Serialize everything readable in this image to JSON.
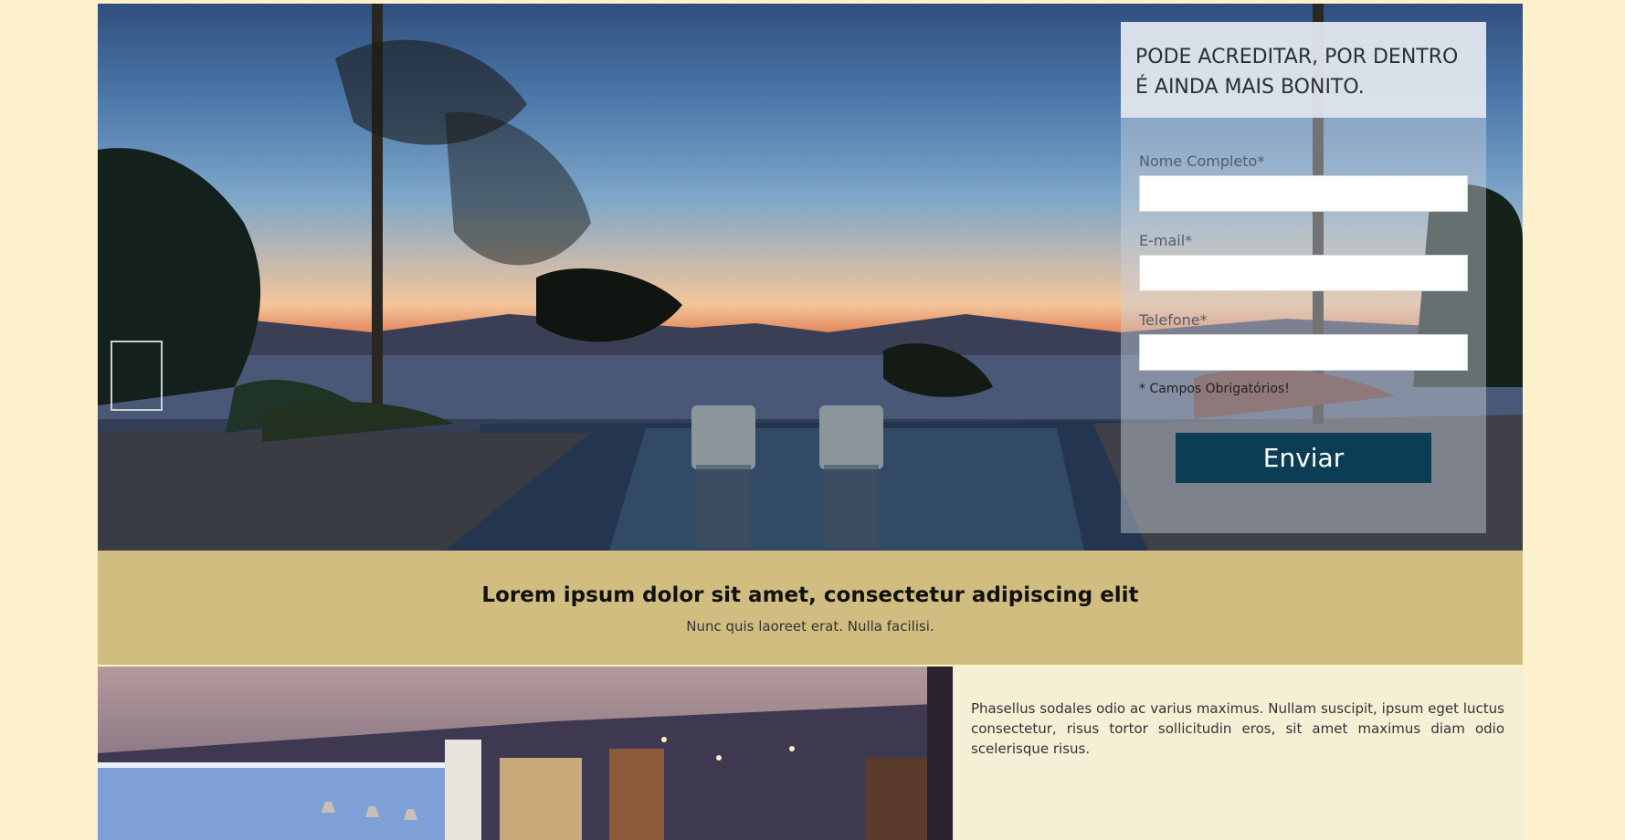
{
  "hero": {
    "image_alt": "sunset-pool-view",
    "form": {
      "title": "PODE ACREDITAR, POR DENTRO É AINDA MAIS BONITO.",
      "fields": [
        {
          "label": "Nome Completo*",
          "value": ""
        },
        {
          "label": "E-mail*",
          "value": ""
        },
        {
          "label": "Telefone*",
          "value": ""
        }
      ],
      "required_note": "* Campos Obrigatórios!",
      "submit_label": "Enviar"
    }
  },
  "band": {
    "title": "Lorem ipsum dolor sit amet, consectetur adipiscing elit",
    "subtitle": "Nunc quis laoreet erat. Nulla facilisi."
  },
  "lower": {
    "image_alt": "interior-lounge",
    "text": "Phasellus sodales odio ac varius maximus. Nullam suscipit, ipsum eget luctus consectetur, risus tortor sollicitudin eros, sit amet maximus diam odio scelerisque risus."
  },
  "colors": {
    "page_bg": "#fcf0cd",
    "band_bg": "#d0bd7f",
    "button_bg": "#0b3d55",
    "lower_bg": "#f5efd6"
  }
}
